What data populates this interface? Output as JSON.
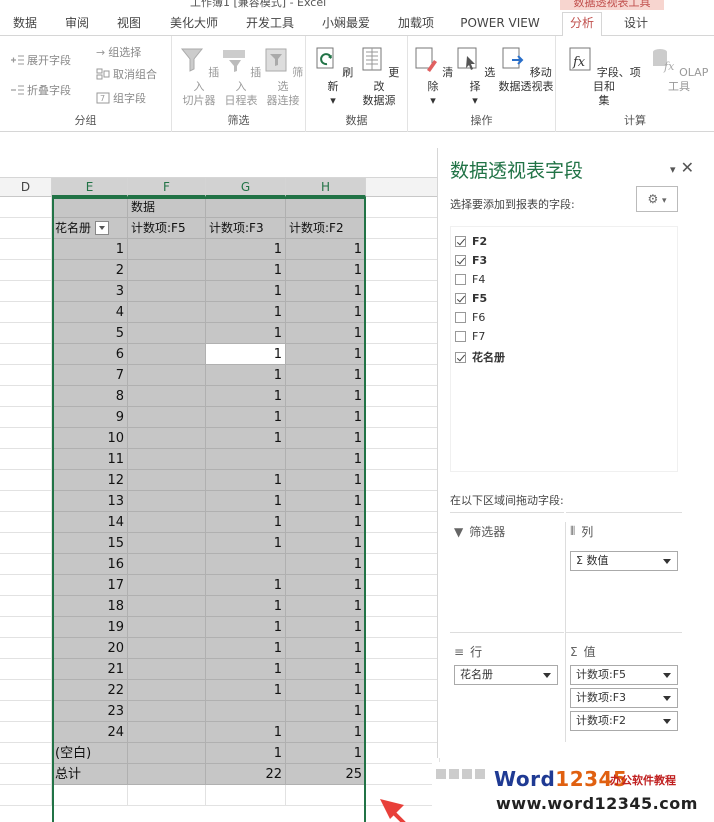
{
  "window": {
    "title_fragment": "工作簿1 [兼容模式] - Excel",
    "context_group": "数据透视表工具"
  },
  "tabs": [
    "数据",
    "审阅",
    "视图",
    "美化大师",
    "开发工具",
    "小娴最爱",
    "加载项",
    "POWER VIEW",
    "分析",
    "设计"
  ],
  "active_tab": "分析",
  "ribbon": {
    "expand_field": "展开字段",
    "collapse_field": "折叠字段",
    "group_selection": "组选择",
    "ungroup": "取消组合",
    "group_field": "组字段",
    "group_label": "分组",
    "insert_slicer": "插入\n切片器",
    "insert_timeline": "插入\n日程表",
    "filter_connections": "筛选\n器连接",
    "filter_label": "筛选",
    "refresh": "刷新",
    "change_source": "更改\n数据源",
    "data_label": "数据",
    "clear": "清除",
    "select": "选择",
    "move_pivot": "移动\n数据透视表",
    "actions_label": "操作",
    "fields_items_sets": "字段、项目和\n集",
    "olap_tools": "OLAP 工具",
    "calculations_label": "计算"
  },
  "columns": [
    "D",
    "E",
    "F",
    "G",
    "H"
  ],
  "pivot": {
    "data_header": "数据",
    "row_label": "花名册",
    "col_f5": "计数项:F5",
    "col_f3": "计数项:F3",
    "col_f2": "计数项:F2",
    "rows": [
      {
        "k": "1",
        "f5": "",
        "f3": "1",
        "f2": "1"
      },
      {
        "k": "2",
        "f5": "",
        "f3": "1",
        "f2": "1"
      },
      {
        "k": "3",
        "f5": "",
        "f3": "1",
        "f2": "1"
      },
      {
        "k": "4",
        "f5": "",
        "f3": "1",
        "f2": "1"
      },
      {
        "k": "5",
        "f5": "",
        "f3": "1",
        "f2": "1"
      },
      {
        "k": "6",
        "f5": "",
        "f3": "1",
        "f2": "1"
      },
      {
        "k": "7",
        "f5": "",
        "f3": "1",
        "f2": "1"
      },
      {
        "k": "8",
        "f5": "",
        "f3": "1",
        "f2": "1"
      },
      {
        "k": "9",
        "f5": "",
        "f3": "1",
        "f2": "1"
      },
      {
        "k": "10",
        "f5": "",
        "f3": "1",
        "f2": "1"
      },
      {
        "k": "11",
        "f5": "",
        "f3": "",
        "f2": "1"
      },
      {
        "k": "12",
        "f5": "",
        "f3": "1",
        "f2": "1"
      },
      {
        "k": "13",
        "f5": "",
        "f3": "1",
        "f2": "1"
      },
      {
        "k": "14",
        "f5": "",
        "f3": "1",
        "f2": "1"
      },
      {
        "k": "15",
        "f5": "",
        "f3": "1",
        "f2": "1"
      },
      {
        "k": "16",
        "f5": "",
        "f3": "",
        "f2": "1"
      },
      {
        "k": "17",
        "f5": "",
        "f3": "1",
        "f2": "1"
      },
      {
        "k": "18",
        "f5": "",
        "f3": "1",
        "f2": "1"
      },
      {
        "k": "19",
        "f5": "",
        "f3": "1",
        "f2": "1"
      },
      {
        "k": "20",
        "f5": "",
        "f3": "1",
        "f2": "1"
      },
      {
        "k": "21",
        "f5": "",
        "f3": "1",
        "f2": "1"
      },
      {
        "k": "22",
        "f5": "",
        "f3": "1",
        "f2": "1"
      },
      {
        "k": "23",
        "f5": "",
        "f3": "",
        "f2": "1"
      },
      {
        "k": "24",
        "f5": "",
        "f3": "1",
        "f2": "1"
      },
      {
        "k": "(空白)",
        "f5": "",
        "f3": "1",
        "f2": "1"
      }
    ],
    "total_label": "总计",
    "total_f5": "",
    "total_f3": "22",
    "total_f2": "25",
    "selected_row_index": 5
  },
  "pane": {
    "title": "数据透视表字段",
    "subtitle": "选择要添加到报表的字段:",
    "fields": [
      {
        "name": "F2",
        "checked": true
      },
      {
        "name": "F3",
        "checked": true
      },
      {
        "name": "F4",
        "checked": false
      },
      {
        "name": "F5",
        "checked": true
      },
      {
        "name": "F6",
        "checked": false
      },
      {
        "name": "F7",
        "checked": false
      },
      {
        "name": "花名册",
        "checked": true
      }
    ],
    "drag_label": "在以下区域间拖动字段:",
    "filters_label": "筛选器",
    "columns_label": "列",
    "rows_label": "行",
    "values_label": "值",
    "columns_chip": "Σ 数值",
    "rows_chip": "花名册",
    "values_chips": [
      "计数项:F5",
      "计数项:F3",
      "计数项:F2"
    ]
  },
  "watermark": {
    "brand_word": "Word",
    "brand_num": "12345",
    "tagline": "办公软件教程",
    "url": "www.word12345.com"
  },
  "colors": {
    "accent_green": "#217346",
    "tab_red": "#c0504d",
    "pivot_gray": "#c6c6c6",
    "arrow_red": "#e8403a"
  }
}
